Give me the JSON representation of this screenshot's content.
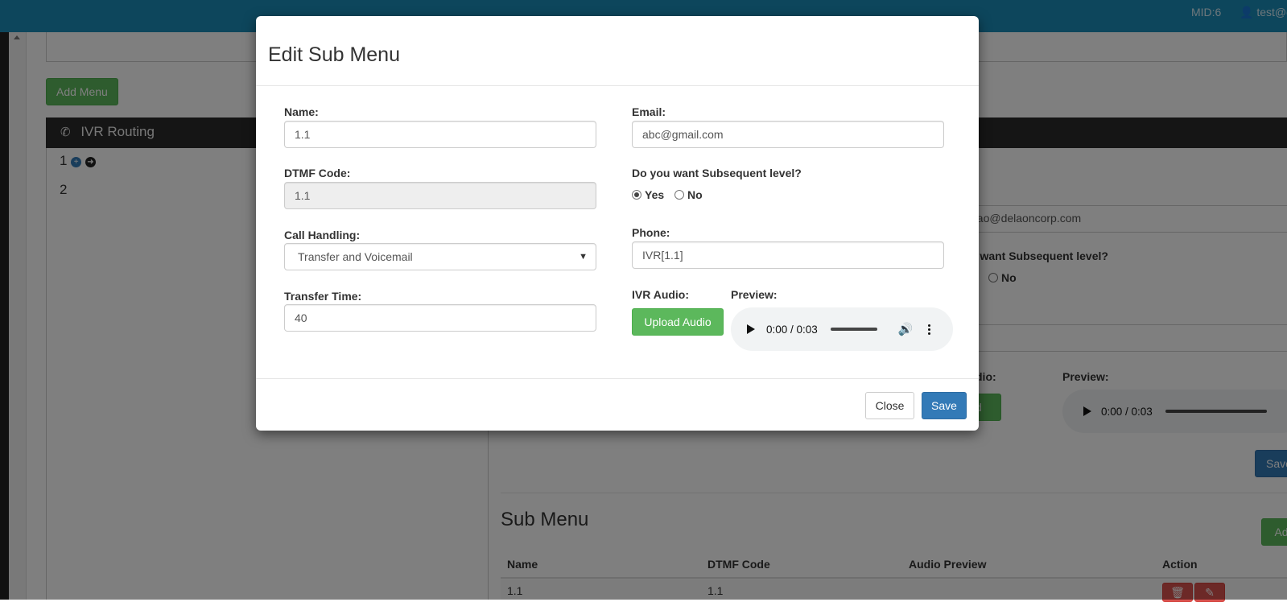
{
  "topbar": {
    "mid": "MID:6",
    "user": "test@d"
  },
  "background": {
    "add_menu_label": "Add Menu",
    "ivr_header": "IVR Routing",
    "tree": [
      "1",
      "2"
    ],
    "email_partial": "nao@delaoncorp.com",
    "subsequent_partial": "u want Subsequent level?",
    "radio_no": "No",
    "phone_partial_label": ":",
    "phone_partial_value": "]",
    "ivr_audio_partial": "dio:",
    "preview_label": "Preview:",
    "upload_partial": "ad",
    "audio_time": "0:00 / 0:03",
    "save_partial": "Save",
    "submenu_title": "Sub Menu",
    "add_partial": "Ad",
    "table_headers": [
      "Name",
      "DTMF Code",
      "Audio Preview",
      "Action"
    ],
    "table_row": [
      "1.1",
      "1.1"
    ]
  },
  "modal": {
    "title": "Edit Sub Menu",
    "name_label": "Name:",
    "name_value": "1.1",
    "email_label": "Email:",
    "email_value": "abc@gmail.com",
    "dtmf_label": "DTMF Code:",
    "dtmf_value": "1.1",
    "subsequent_label": "Do you want Subsequent level?",
    "radio_yes": "Yes",
    "radio_no": "No",
    "call_handling_label": "Call Handling:",
    "call_handling_value": "Transfer and Voicemail",
    "phone_label": "Phone:",
    "phone_value": "IVR[1.1]",
    "transfer_time_label": "Transfer Time:",
    "transfer_time_value": "40",
    "ivr_audio_label": "IVR Audio:",
    "upload_label": "Upload Audio",
    "preview_label": "Preview:",
    "audio_time": "0:00 / 0:03",
    "close_label": "Close",
    "save_label": "Save"
  },
  "icons": {
    "phone": "phone-icon",
    "plus": "plus-circle-icon",
    "arrow": "arrow-circle-right-icon",
    "user": "user-icon",
    "caret": "caret-down-icon",
    "play": "play-icon",
    "volume": "volume-icon",
    "more": "more-vertical-icon",
    "trash": "trash-icon",
    "edit": "edit-icon"
  },
  "colors": {
    "topbar": "#1a8cb8",
    "success": "#5cb85c",
    "primary": "#337ab7",
    "danger": "#d9534f"
  }
}
